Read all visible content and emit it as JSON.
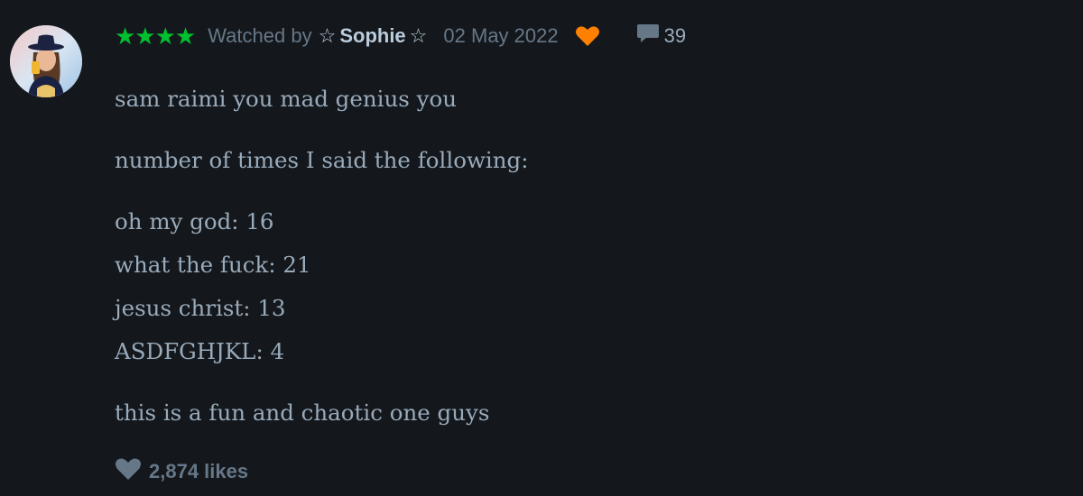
{
  "review": {
    "rating_stars": "★★★★",
    "watched_label": "Watched by",
    "reviewer_name": "Sophie",
    "star_decoration": "☆",
    "date": "02 May 2022",
    "liked_icon": "heart-icon",
    "liked_color": "#ff8000",
    "comment_count": "39",
    "paragraphs": [
      "sam raimi you mad genius you",
      "number of times I said the following:"
    ],
    "tally": [
      "oh my god: 16",
      "what the fuck: 21",
      "jesus christ: 13",
      "ASDFGHJKL: 4"
    ],
    "closing": "this is a fun and chaotic one guys",
    "likes": "2,874 likes"
  },
  "colors": {
    "background": "#14181c",
    "star_green": "#00c030",
    "muted_text": "#678",
    "body_text": "#9ab"
  }
}
